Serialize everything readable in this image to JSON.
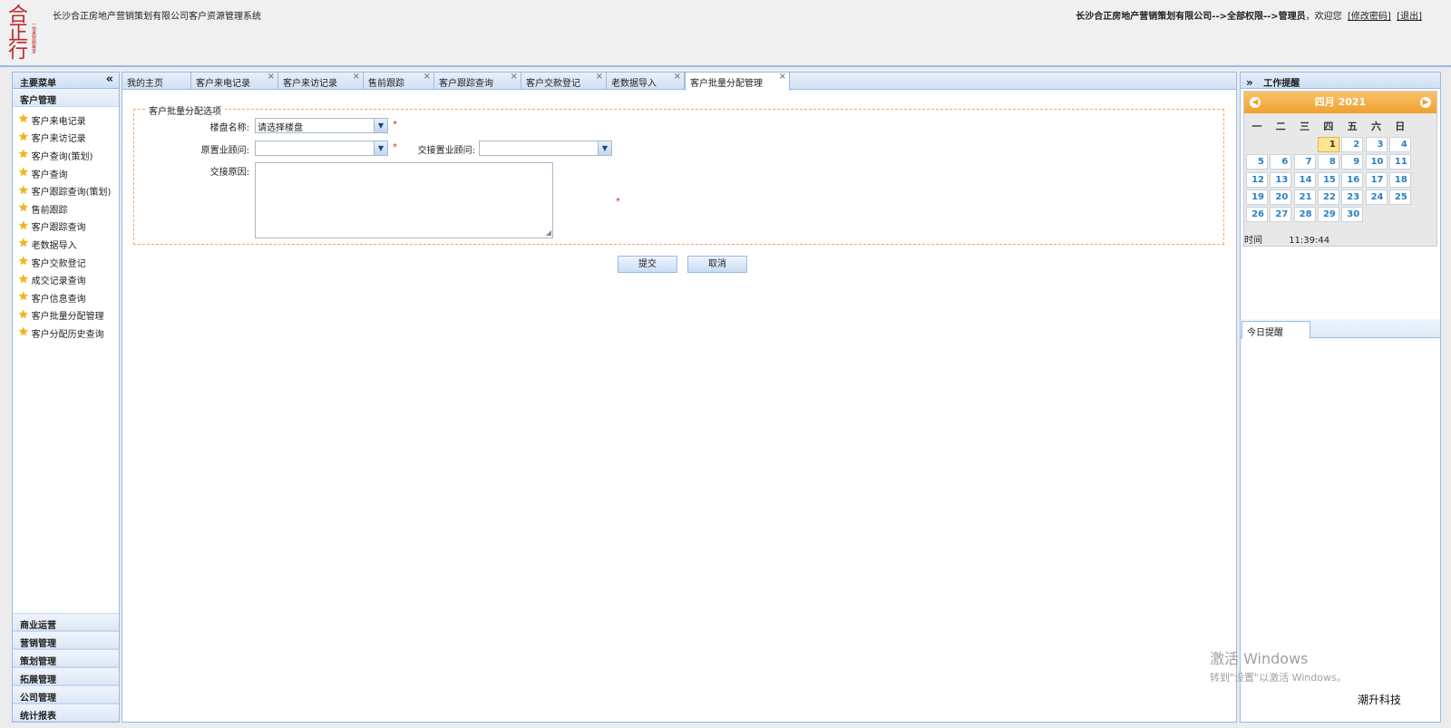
{
  "header": {
    "logo_text": "合正行",
    "logo_sub": "一地產營銷專家",
    "app_title": "长沙合正房地产营销策划有限公司客户资源管理系统",
    "user_path": "长沙合正房地产营销策划有限公司-->全部权限-->管理员",
    "welcome": "，欢迎您",
    "change_pwd": "[修改密码]",
    "logout": "[退出]"
  },
  "sidebar": {
    "title": "主要菜单",
    "collapse_icon": "«",
    "active_group": "客户管理",
    "items": [
      "客户来电记录",
      "客户来访记录",
      "客户查询(策划)",
      "客户查询",
      "客户跟踪查询(策划)",
      "售前跟踪",
      "客户跟踪查询",
      "老数据导入",
      "客户交款登记",
      "成交记录查询",
      "客户信息查询",
      "客户批量分配管理",
      "客户分配历史查询"
    ],
    "groups": [
      "商业运营",
      "营销管理",
      "策划管理",
      "拓展管理",
      "公司管理",
      "统计报表"
    ]
  },
  "tabs": [
    {
      "label": "我的主页",
      "closable": false
    },
    {
      "label": "客户来电记录",
      "closable": true
    },
    {
      "label": "客户来访记录",
      "closable": true
    },
    {
      "label": "售前跟踪",
      "closable": true
    },
    {
      "label": "客户跟踪查询",
      "closable": true
    },
    {
      "label": "客户交款登记",
      "closable": true
    },
    {
      "label": "老数据导入",
      "closable": true
    },
    {
      "label": "客户批量分配管理",
      "closable": true,
      "active": true
    }
  ],
  "close_glyph": "×",
  "form": {
    "legend": "客户批量分配选项",
    "building_label": "楼盘名称:",
    "building_value": "请选择楼盘",
    "orig_consultant_label": "原置业顾问:",
    "orig_consultant_value": "",
    "handover_consultant_label": "交接置业顾问:",
    "handover_consultant_value": "",
    "reason_label": "交接原因:",
    "reason_value": "",
    "required_mark": "*",
    "submit_label": "提交",
    "cancel_label": "取消"
  },
  "right_panel": {
    "title": "工作提醒",
    "expand_icon": "»",
    "calendar": {
      "month_title": "四月 2021",
      "weekdays": [
        "一",
        "二",
        "三",
        "四",
        "五",
        "六",
        "日"
      ],
      "first_weekday_index": 3,
      "days_in_month": 30,
      "today": 1,
      "time_label": "时间",
      "time_value": "11:39:44"
    },
    "today_tab": "今日提醒"
  },
  "watermark": {
    "line1": "激活 Windows",
    "line2": "转到\"设置\"以激活 Windows。"
  },
  "brand": "潮升科技",
  "colors": {
    "border": "#99bbe8",
    "accent_orange": "#f0a030",
    "required_red": "#e02020",
    "day_blue": "#2a7fc8"
  }
}
